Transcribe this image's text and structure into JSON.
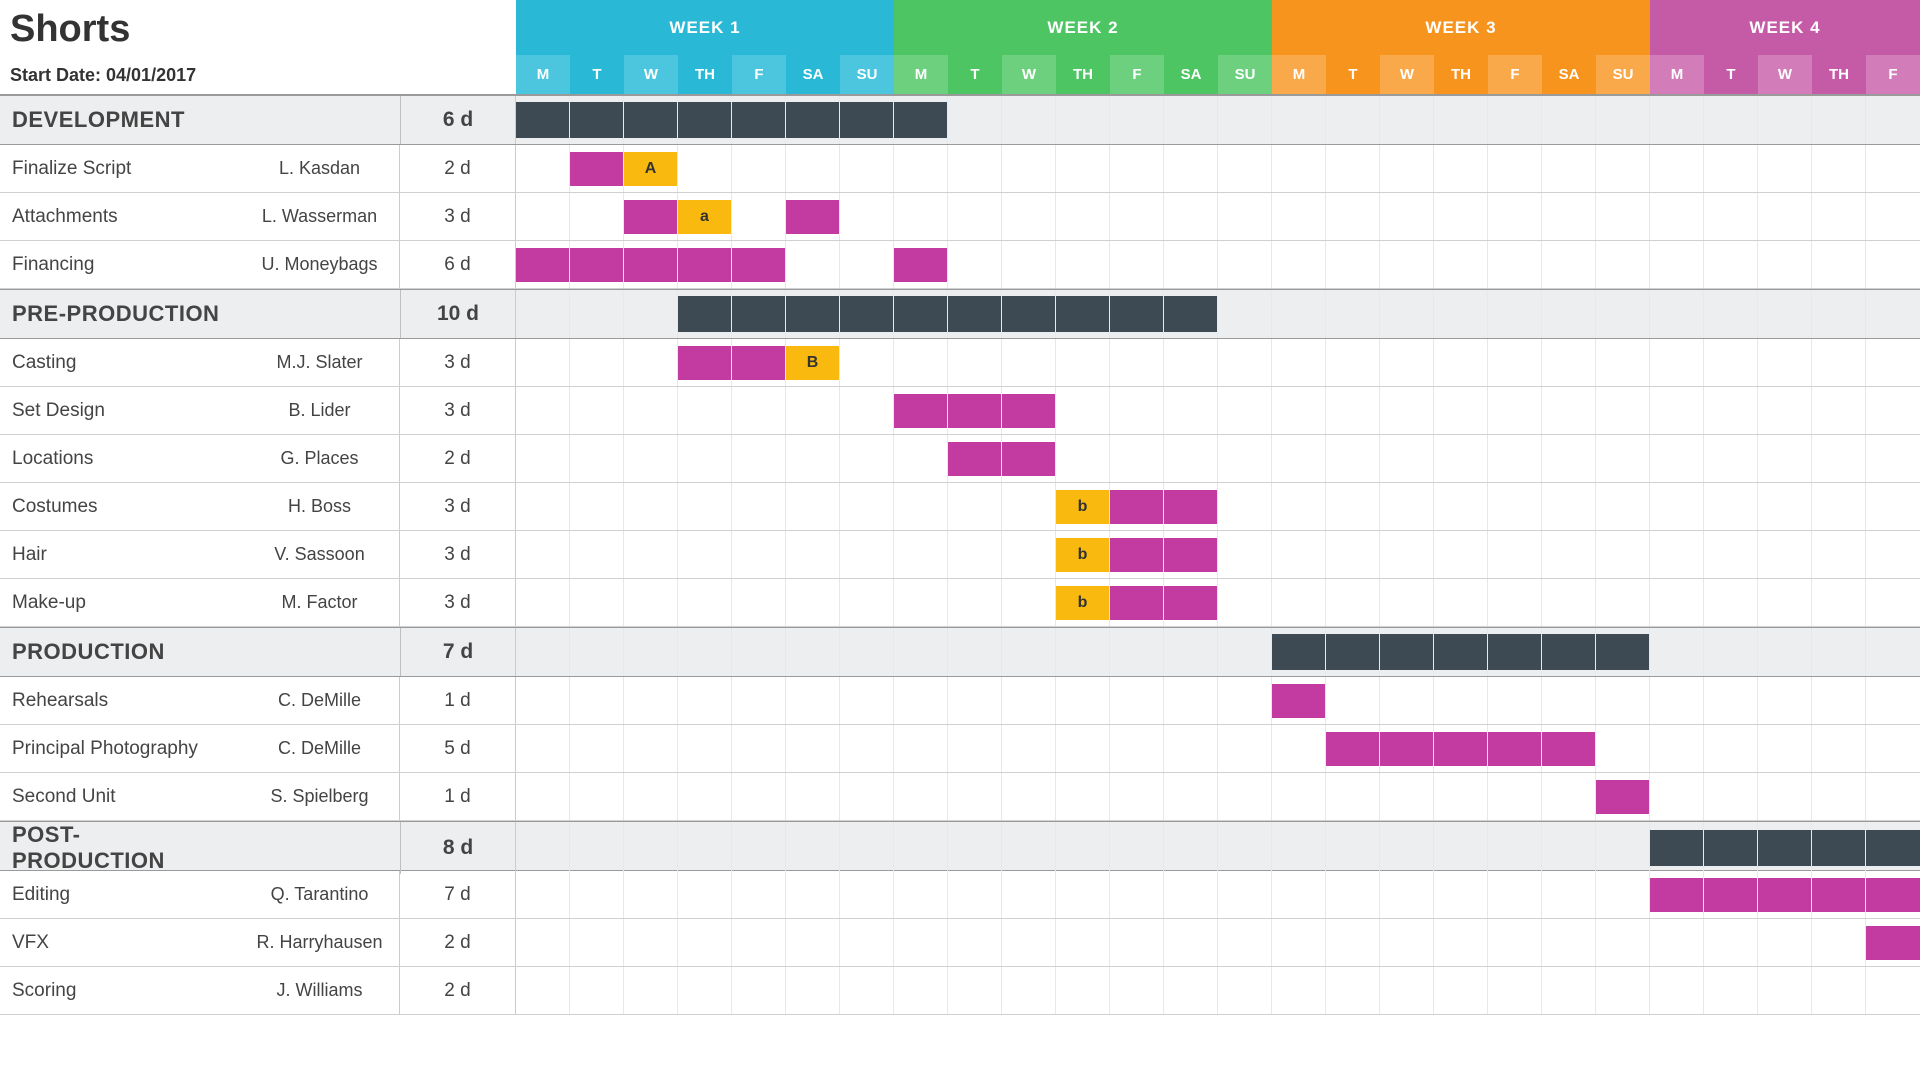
{
  "title": "Shorts",
  "start_date_label": "Start Date: 04/01/2017",
  "weeks": [
    {
      "label": "WEEK 1",
      "cls": "wk1",
      "days": 7,
      "dayCls": "w1"
    },
    {
      "label": "WEEK 2",
      "cls": "wk2",
      "days": 7,
      "dayCls": "w2"
    },
    {
      "label": "WEEK 3",
      "cls": "wk3",
      "days": 7,
      "dayCls": "w3"
    },
    {
      "label": "WEEK 4",
      "cls": "wk4",
      "days": 5,
      "dayCls": "w4"
    }
  ],
  "day_labels": [
    "M",
    "T",
    "W",
    "TH",
    "F",
    "SA",
    "SU"
  ],
  "rows": [
    {
      "type": "phase",
      "task": "DEVELOPMENT",
      "owner": "",
      "dur": "6 d",
      "bars": [
        {
          "start": 0,
          "len": 8,
          "kind": "dark"
        }
      ]
    },
    {
      "type": "task",
      "task": "Finalize Script",
      "owner": "L. Kasdan",
      "dur": "2 d",
      "bars": [
        {
          "start": 1,
          "len": 1,
          "kind": "magenta"
        },
        {
          "start": 2,
          "len": 1,
          "kind": "yellow",
          "label": "A"
        }
      ]
    },
    {
      "type": "task",
      "task": "Attachments",
      "owner": "L. Wasserman",
      "dur": "3 d",
      "bars": [
        {
          "start": 2,
          "len": 1,
          "kind": "magenta"
        },
        {
          "start": 3,
          "len": 1,
          "kind": "yellow",
          "label": "a"
        },
        {
          "start": 5,
          "len": 1,
          "kind": "magenta"
        }
      ]
    },
    {
      "type": "task",
      "task": "Financing",
      "owner": "U. Moneybags",
      "dur": "6 d",
      "bars": [
        {
          "start": 0,
          "len": 5,
          "kind": "magenta"
        },
        {
          "start": 7,
          "len": 1,
          "kind": "magenta"
        }
      ]
    },
    {
      "type": "phase",
      "task": "PRE-PRODUCTION",
      "owner": "",
      "dur": "10 d",
      "bars": [
        {
          "start": 3,
          "len": 10,
          "kind": "dark"
        }
      ]
    },
    {
      "type": "task",
      "task": "Casting",
      "owner": "M.J. Slater",
      "dur": "3 d",
      "bars": [
        {
          "start": 3,
          "len": 2,
          "kind": "magenta"
        },
        {
          "start": 5,
          "len": 1,
          "kind": "yellow",
          "label": "B"
        }
      ]
    },
    {
      "type": "task",
      "task": "Set Design",
      "owner": "B. Lider",
      "dur": "3 d",
      "bars": [
        {
          "start": 7,
          "len": 3,
          "kind": "magenta"
        }
      ]
    },
    {
      "type": "task",
      "task": "Locations",
      "owner": "G. Places",
      "dur": "2 d",
      "bars": [
        {
          "start": 8,
          "len": 2,
          "kind": "magenta"
        }
      ]
    },
    {
      "type": "task",
      "task": "Costumes",
      "owner": "H. Boss",
      "dur": "3 d",
      "bars": [
        {
          "start": 10,
          "len": 1,
          "kind": "yellow",
          "label": "b"
        },
        {
          "start": 11,
          "len": 2,
          "kind": "magenta"
        }
      ]
    },
    {
      "type": "task",
      "task": "Hair",
      "owner": "V. Sassoon",
      "dur": "3 d",
      "bars": [
        {
          "start": 10,
          "len": 1,
          "kind": "yellow",
          "label": "b"
        },
        {
          "start": 11,
          "len": 2,
          "kind": "magenta"
        }
      ]
    },
    {
      "type": "task",
      "task": "Make-up",
      "owner": "M. Factor",
      "dur": "3 d",
      "bars": [
        {
          "start": 10,
          "len": 1,
          "kind": "yellow",
          "label": "b"
        },
        {
          "start": 11,
          "len": 2,
          "kind": "magenta"
        }
      ]
    },
    {
      "type": "phase",
      "task": "PRODUCTION",
      "owner": "",
      "dur": "7 d",
      "bars": [
        {
          "start": 14,
          "len": 7,
          "kind": "dark"
        }
      ]
    },
    {
      "type": "task",
      "task": "Rehearsals",
      "owner": "C. DeMille",
      "dur": "1 d",
      "bars": [
        {
          "start": 14,
          "len": 1,
          "kind": "magenta"
        }
      ]
    },
    {
      "type": "task",
      "task": "Principal Photography",
      "owner": "C. DeMille",
      "dur": "5 d",
      "bars": [
        {
          "start": 15,
          "len": 5,
          "kind": "magenta"
        }
      ]
    },
    {
      "type": "task",
      "task": "Second Unit",
      "owner": "S. Spielberg",
      "dur": "1 d",
      "bars": [
        {
          "start": 20,
          "len": 1,
          "kind": "magenta"
        }
      ]
    },
    {
      "type": "phase",
      "task": "POST-PRODUCTION",
      "owner": "",
      "dur": "8 d",
      "bars": [
        {
          "start": 21,
          "len": 5,
          "kind": "dark"
        }
      ]
    },
    {
      "type": "task",
      "task": "Editing",
      "owner": "Q. Tarantino",
      "dur": "7 d",
      "bars": [
        {
          "start": 21,
          "len": 5,
          "kind": "magenta"
        }
      ]
    },
    {
      "type": "task",
      "task": "VFX",
      "owner": "R. Harryhausen",
      "dur": "2 d",
      "bars": [
        {
          "start": 25,
          "len": 1,
          "kind": "magenta"
        }
      ]
    },
    {
      "type": "task",
      "task": "Scoring",
      "owner": "J. Williams",
      "dur": "2 d",
      "bars": []
    }
  ],
  "chart_data": {
    "type": "gantt",
    "title": "Shorts",
    "start_date": "04/01/2017",
    "x_unit": "day index (0-based from 04/01/2017)",
    "columns": 26,
    "weeks": [
      {
        "name": "WEEK 1",
        "columns": [
          0,
          6
        ]
      },
      {
        "name": "WEEK 2",
        "columns": [
          7,
          13
        ]
      },
      {
        "name": "WEEK 3",
        "columns": [
          14,
          20
        ]
      },
      {
        "name": "WEEK 4",
        "columns": [
          21,
          25
        ]
      }
    ],
    "phases": [
      {
        "name": "DEVELOPMENT",
        "duration_days": 6,
        "span": [
          0,
          7
        ],
        "tasks": [
          {
            "name": "Finalize Script",
            "owner": "L. Kasdan",
            "duration_days": 2,
            "segments": [
              [
                1,
                1
              ],
              [
                2,
                2
              ]
            ],
            "milestone": "A"
          },
          {
            "name": "Attachments",
            "owner": "L. Wasserman",
            "duration_days": 3,
            "segments": [
              [
                2,
                2
              ],
              [
                3,
                3
              ],
              [
                5,
                5
              ]
            ],
            "milestone": "a"
          },
          {
            "name": "Financing",
            "owner": "U. Moneybags",
            "duration_days": 6,
            "segments": [
              [
                0,
                4
              ],
              [
                7,
                7
              ]
            ]
          }
        ]
      },
      {
        "name": "PRE-PRODUCTION",
        "duration_days": 10,
        "span": [
          3,
          12
        ],
        "tasks": [
          {
            "name": "Casting",
            "owner": "M.J. Slater",
            "duration_days": 3,
            "segments": [
              [
                3,
                4
              ],
              [
                5,
                5
              ]
            ],
            "milestone": "B"
          },
          {
            "name": "Set Design",
            "owner": "B. Lider",
            "duration_days": 3,
            "segments": [
              [
                7,
                9
              ]
            ]
          },
          {
            "name": "Locations",
            "owner": "G. Places",
            "duration_days": 2,
            "segments": [
              [
                8,
                9
              ]
            ]
          },
          {
            "name": "Costumes",
            "owner": "H. Boss",
            "duration_days": 3,
            "segments": [
              [
                10,
                10
              ],
              [
                11,
                12
              ]
            ],
            "milestone": "b"
          },
          {
            "name": "Hair",
            "owner": "V. Sassoon",
            "duration_days": 3,
            "segments": [
              [
                10,
                10
              ],
              [
                11,
                12
              ]
            ],
            "milestone": "b"
          },
          {
            "name": "Make-up",
            "owner": "M. Factor",
            "duration_days": 3,
            "segments": [
              [
                10,
                10
              ],
              [
                11,
                12
              ]
            ],
            "milestone": "b"
          }
        ]
      },
      {
        "name": "PRODUCTION",
        "duration_days": 7,
        "span": [
          14,
          20
        ],
        "tasks": [
          {
            "name": "Rehearsals",
            "owner": "C. DeMille",
            "duration_days": 1,
            "segments": [
              [
                14,
                14
              ]
            ]
          },
          {
            "name": "Principal Photography",
            "owner": "C. DeMille",
            "duration_days": 5,
            "segments": [
              [
                15,
                19
              ]
            ]
          },
          {
            "name": "Second Unit",
            "owner": "S. Spielberg",
            "duration_days": 1,
            "segments": [
              [
                20,
                20
              ]
            ]
          }
        ]
      },
      {
        "name": "POST-PRODUCTION",
        "duration_days": 8,
        "span": [
          21,
          25
        ],
        "tasks": [
          {
            "name": "Editing",
            "owner": "Q. Tarantino",
            "duration_days": 7,
            "segments": [
              [
                21,
                25
              ]
            ]
          },
          {
            "name": "VFX",
            "owner": "R. Harryhausen",
            "duration_days": 2,
            "segments": [
              [
                25,
                25
              ]
            ]
          },
          {
            "name": "Scoring",
            "owner": "J. Williams",
            "duration_days": 2,
            "segments": []
          }
        ]
      }
    ]
  }
}
